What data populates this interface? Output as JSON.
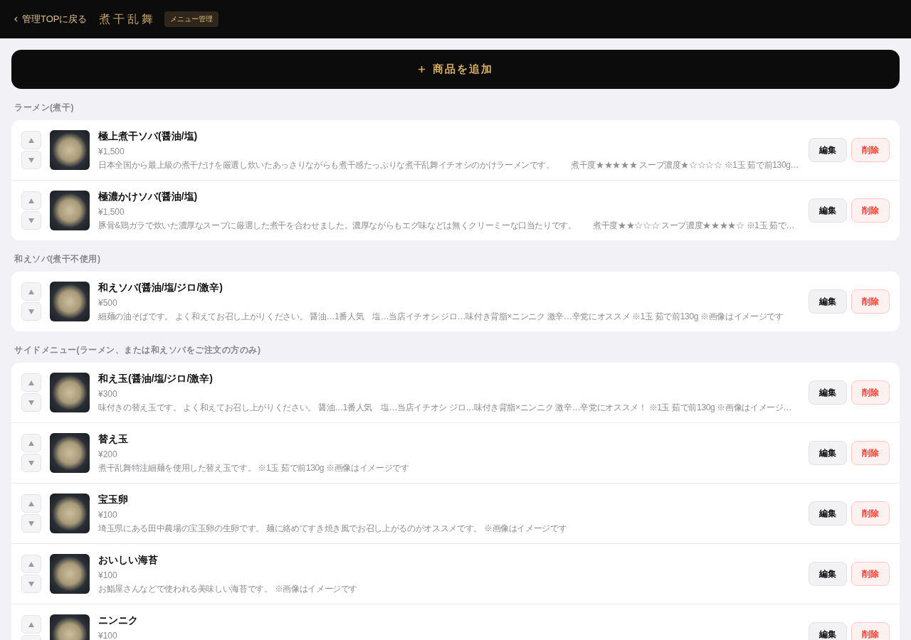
{
  "header": {
    "back_link": "管理TOPに戻る",
    "logo": "煮干乱舞",
    "badge": "メニュー管理"
  },
  "add_button": {
    "label": "商品を追加"
  },
  "sections": [
    {
      "title": "ラーメン(煮干)",
      "items": [
        {
          "name": "極上煮干ソバ(醤油/塩)",
          "price": "¥1,500",
          "description": "日本全国から最上級の煮干だけを厳選し炊いたあっさりながらも煮干感たっぷりな煮干乱舞イチオシのかけラーメンです。　　煮干度★★★★★ スープ濃度★☆☆☆☆ ※1玉 茹で前130g…",
          "edit": "編集",
          "delete": "削除"
        },
        {
          "name": "極濃かけソバ(醤油/塩)",
          "price": "¥1,500",
          "description": "豚骨&鶏ガラで炊いた濃厚なスープに厳選した煮干を合わせました。濃厚ながらもエグ味などは無くクリーミーな口当たりです。　　煮干度★★☆☆☆ スープ濃度★★★★☆ ※1玉 茹で…",
          "edit": "編集",
          "delete": "削除"
        }
      ]
    },
    {
      "title": "和えソバ(煮干不使用)",
      "items": [
        {
          "name": "和えソバ(醤油/塩/ジロ/激辛)",
          "price": "¥500",
          "description": "細麺の油そばです。 よく和えてお召し上がりください。 醤油…1番人気　塩…当店イチオシ ジロ…味付き背脂×ニンニク 激辛…辛党にオススメ ※1玉 茹で前130g ※画像はイメージです",
          "edit": "編集",
          "delete": "削除"
        }
      ]
    },
    {
      "title": "サイドメニュー(ラーメン、または和えソバをご注文の方のみ)",
      "items": [
        {
          "name": "和え玉(醤油/塩/ジロ/激辛)",
          "price": "¥300",
          "description": "味付きの替え玉です。 よく和えてお召し上がりください。 醤油…1番人気　塩…当店イチオシ ジロ…味付き背脂×ニンニク 激辛…辛党にオススメ！ ※1玉 茹で前130g ※画像はイメージ…",
          "edit": "編集",
          "delete": "削除"
        },
        {
          "name": "替え玉",
          "price": "¥200",
          "description": "煮干乱舞特注細麺を使用した替え玉です。 ※1玉 茹で前130g ※画像はイメージです",
          "edit": "編集",
          "delete": "削除"
        },
        {
          "name": "宝玉卵",
          "price": "¥100",
          "description": "埼玉県にある田中農場の宝玉卵の生卵です。 麺に絡めてすき焼き風でお召し上がるのがオススメです。 ※画像はイメージです",
          "edit": "編集",
          "delete": "削除"
        },
        {
          "name": "おいしい海苔",
          "price": "¥100",
          "description": "お鮨屋さんなどで使われる美味しい海苔です。 ※画像はイメージです",
          "edit": "編集",
          "delete": "削除"
        },
        {
          "name": "ニンニク",
          "price": "¥100",
          "edit": "編集",
          "delete": "削除"
        }
      ]
    }
  ]
}
